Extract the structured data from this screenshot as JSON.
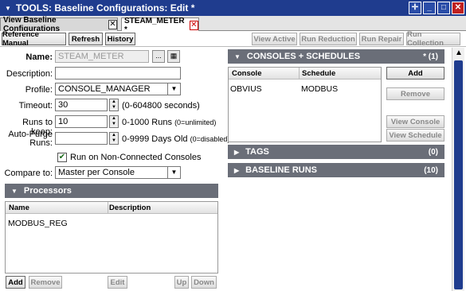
{
  "window": {
    "title": "TOOLS: Baseline Configurations: Edit *",
    "controls": [
      "move",
      "minimize",
      "maximize",
      "close"
    ]
  },
  "tabs": [
    {
      "label": "View Baseline Configurations"
    },
    {
      "label": "STEAM_METER *"
    }
  ],
  "toolbar": {
    "reference_manual": "Reference Manual",
    "refresh": "Refresh",
    "history": "History",
    "view_active": "View Active",
    "run_reduction": "Run Reduction",
    "run_repair": "Run Repair",
    "run_collection": "Run Collection"
  },
  "form": {
    "name_label": "Name:",
    "name_value": "STEAM_METER",
    "description_label": "Description:",
    "description_value": "",
    "profile_label": "Profile:",
    "profile_value": "CONSOLE_MANAGER",
    "timeout_label": "Timeout:",
    "timeout_value": "30",
    "timeout_note": "(0-604800 seconds)",
    "runs_label": "Runs to keep:",
    "runs_value": "10",
    "runs_note": "0-1000 Runs",
    "runs_note_small": "(0=unlimited)",
    "autopurge_label_1": "Auto-Purge",
    "autopurge_label_2": "Runs:",
    "autopurge_value": "",
    "autopurge_note": "0-9999 Days Old",
    "autopurge_note_small": "(0=disabled)",
    "nonconnected_label": "Run on Non-Connected Consoles",
    "nonconnected_checked": true,
    "compare_label": "Compare to:",
    "compare_value": "Master per Console"
  },
  "processors": {
    "header": "Processors",
    "columns": [
      "Name",
      "Description"
    ],
    "rows": [
      {
        "name": "MODBUS_REG",
        "description": ""
      }
    ],
    "buttons": {
      "add": "Add",
      "remove": "Remove",
      "edit": "Edit",
      "up": "Up",
      "down": "Down"
    }
  },
  "consoles": {
    "header": "CONSOLES + SCHEDULES",
    "count": "* (1)",
    "columns": [
      "Console",
      "Schedule"
    ],
    "rows": [
      {
        "console": "OBVIUS",
        "schedule": "MODBUS"
      }
    ],
    "buttons": {
      "add": "Add",
      "remove": "Remove",
      "view_console": "View Console",
      "view_schedule": "View Schedule"
    }
  },
  "tags": {
    "header": "TAGS",
    "count": "(0)"
  },
  "baseline_runs": {
    "header": "BASELINE RUNS",
    "count": "(10)"
  },
  "colors": {
    "titlebar": "#1f3c8e",
    "section_header": "#6a6e78",
    "close_red": "#c02020"
  }
}
